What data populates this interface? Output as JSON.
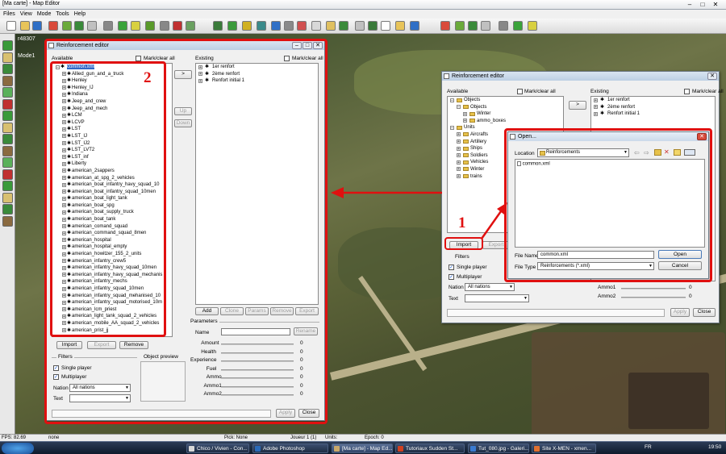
{
  "app": {
    "title": "[Ma carte] - Map Editor",
    "coords": "r48307",
    "mode": "Mode1"
  },
  "menu": [
    "Files",
    "View",
    "Mode",
    "Tools",
    "Help"
  ],
  "left_dialog": {
    "title": "Reinforcement editor",
    "available_label": "Available",
    "mark_clear": "Mark/clear all",
    "existing_label": "Existing",
    "available_items": [
      "common.xml",
      "Allied_gun_and_a_truck",
      "Henley",
      "Henley_IJ",
      "Indiana",
      "Jeep_and_crew",
      "Jeep_and_mech",
      "LCM",
      "LCVP",
      "LST",
      "LST_IJ",
      "LST_IJ2",
      "LST_LVT2",
      "LST_inf",
      "Liberty",
      "american_2sappers",
      "american_at_spg_2_vehicles",
      "american_boat_infantry_havy_squad_10",
      "american_boat_infantry_squad_10men",
      "american_boat_light_tank",
      "american_boat_spg",
      "american_boat_supply_truck",
      "american_boat_tank",
      "american_comand_squad",
      "american_command_squad_8men",
      "american_hospital",
      "american_hospital_empty",
      "american_howitzer_155_2_units",
      "american_infantry_crew5",
      "american_infantry_havy_squad_10men",
      "american_infantry_havy_squad_mechanis",
      "american_infantry_mechs",
      "american_infantry_squad_10men",
      "american_infantry_squad_mehanised_10",
      "american_infantry_squad_motorised_10m",
      "american_lcm_priest",
      "american_light_tank_squad_2_vehicles",
      "american_mobile_AA_squad_2_vehicles",
      "american_prist_jj"
    ],
    "existing_items": [
      "1er renfort",
      "2ème renfort",
      "Renfort initial 1"
    ],
    "transfer_btn": ">",
    "up_btn": "Up",
    "down_btn": "Down",
    "existing_buttons": [
      "Add",
      "Clone",
      "Params",
      "Remove",
      "Export"
    ],
    "params_label": "Parameters",
    "name_label": "Name",
    "rename_btn": "Rename",
    "params": [
      {
        "label": "Amount",
        "value": "0"
      },
      {
        "label": "Health",
        "value": "0"
      },
      {
        "label": "Experience",
        "value": "0"
      },
      {
        "label": "Fuel",
        "value": "0"
      },
      {
        "label": "Ammo",
        "value": "0"
      },
      {
        "label": "Ammo1",
        "value": "0"
      },
      {
        "label": "Ammo2",
        "value": "0"
      }
    ],
    "bottom_buttons": [
      "Import",
      "Export",
      "Remove"
    ],
    "filters_label": "Filters",
    "object_preview": "Object preview",
    "single_player": "Single player",
    "multiplayer": "Multiplayer",
    "nation_label": "Nation",
    "nation_value": "All nations",
    "text_label": "Text",
    "apply_btn": "Apply",
    "close_btn": "Close"
  },
  "right_dialog": {
    "title": "Reinforcement editor",
    "available_label": "Available",
    "mark_clear": "Mark/clear all",
    "existing_label": "Existing",
    "tree": [
      {
        "label": "Objects",
        "level": 0
      },
      {
        "label": "Objects",
        "level": 1
      },
      {
        "label": "Winter",
        "level": 2
      },
      {
        "label": "ammo_boxes",
        "level": 2
      },
      {
        "label": "Units",
        "level": 0
      },
      {
        "label": "Aircrafts",
        "level": 1
      },
      {
        "label": "Artillery",
        "level": 1
      },
      {
        "label": "Ships",
        "level": 1
      },
      {
        "label": "Soldiers",
        "level": 1
      },
      {
        "label": "Vehicles",
        "level": 1
      },
      {
        "label": "Winter",
        "level": 1
      },
      {
        "label": "trains",
        "level": 1
      }
    ],
    "existing_items": [
      "1er renfort",
      "2ème renfort",
      "Renfort initial 1"
    ],
    "transfer_btn": ">",
    "import_btn": "Import",
    "export_btn": "Export",
    "filters_label": "Filters",
    "single_player": "Single player",
    "multiplayer": "Multiplayer",
    "nation_label": "Nation",
    "nation_value": "All nations",
    "text_label": "Text",
    "ammo1": "Ammo1",
    "ammo2": "Ammo2",
    "val": "0",
    "apply_btn": "Apply",
    "close_btn": "Close"
  },
  "open_dialog": {
    "title": "Open...",
    "location_label": "Location",
    "location_value": "Reinforcements",
    "files": [
      "common.xml"
    ],
    "file_name_label": "File Name",
    "file_name_value": "common.xml",
    "file_type_label": "File Type",
    "file_type_value": "Reinforcements (*.xml)",
    "open_btn": "Open",
    "cancel_btn": "Cancel"
  },
  "annotations": {
    "one": "1",
    "two": "2"
  },
  "status": {
    "fps": "FPS: 82.69",
    "none": "none",
    "pick": "Pick: None",
    "joueur": "Joueur 1 (1)",
    "units": "Units:",
    "epoch": "Epoch: 0"
  },
  "taskbar": {
    "tasks": [
      "Chico / Vivien - Con...",
      "Adobe Photoshop",
      "[Ma carte] - Map Ed...",
      "Tutoriaux Sudden St...",
      "Tut_080.jpg - Galeri...",
      "Site X-MEN - xmen..."
    ],
    "lang": "FR",
    "time": "19:50"
  },
  "colors": {
    "annotation_red": "#e01010",
    "selection_blue": "#3169c6"
  }
}
